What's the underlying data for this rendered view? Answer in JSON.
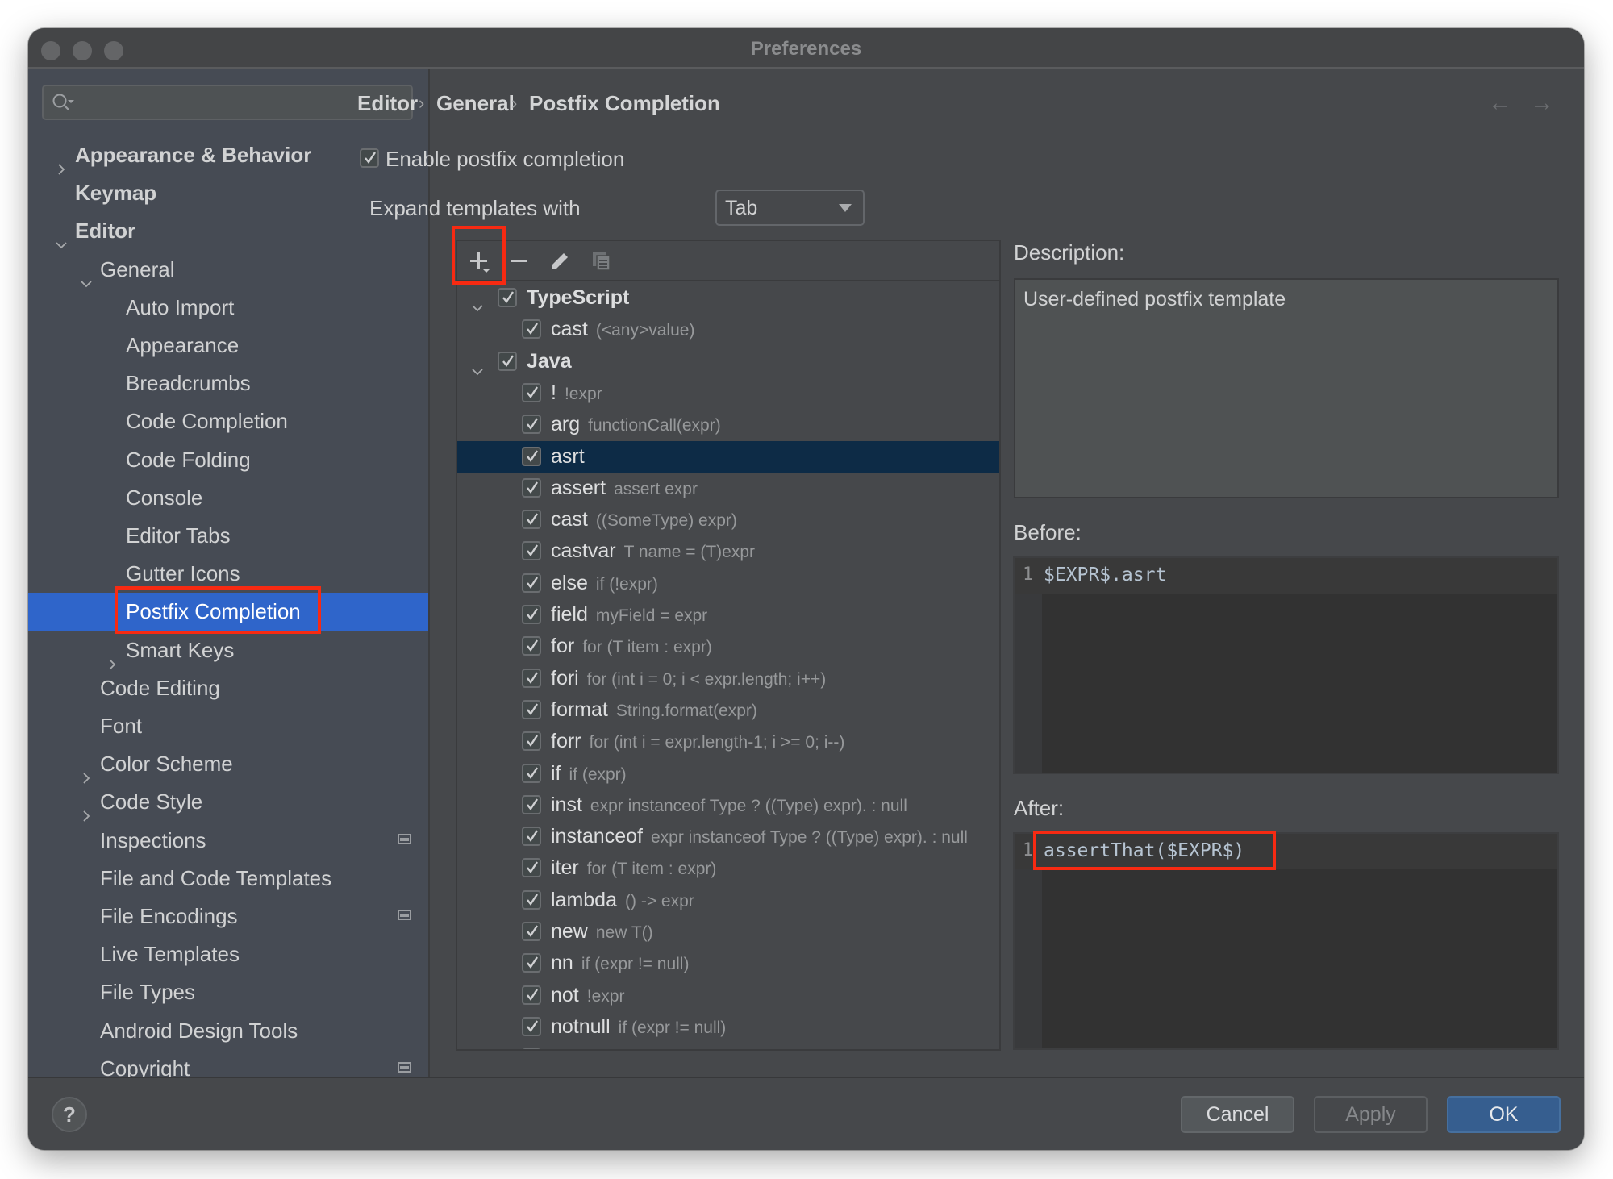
{
  "window": {
    "title": "Preferences"
  },
  "sidebar": {
    "search": {
      "value": "",
      "placeholder": ""
    },
    "items": [
      {
        "label": "Appearance & Behavior",
        "level": 0,
        "bold": true,
        "chevron": "right"
      },
      {
        "label": "Keymap",
        "level": 0,
        "bold": true,
        "chevron": ""
      },
      {
        "label": "Editor",
        "level": 0,
        "bold": true,
        "chevron": "down"
      },
      {
        "label": "General",
        "level": 1,
        "bold": false,
        "chevron": "down"
      },
      {
        "label": "Auto Import",
        "level": 2,
        "bold": false,
        "chevron": ""
      },
      {
        "label": "Appearance",
        "level": 2,
        "bold": false,
        "chevron": ""
      },
      {
        "label": "Breadcrumbs",
        "level": 2,
        "bold": false,
        "chevron": ""
      },
      {
        "label": "Code Completion",
        "level": 2,
        "bold": false,
        "chevron": ""
      },
      {
        "label": "Code Folding",
        "level": 2,
        "bold": false,
        "chevron": ""
      },
      {
        "label": "Console",
        "level": 2,
        "bold": false,
        "chevron": ""
      },
      {
        "label": "Editor Tabs",
        "level": 2,
        "bold": false,
        "chevron": ""
      },
      {
        "label": "Gutter Icons",
        "level": 2,
        "bold": false,
        "chevron": ""
      },
      {
        "label": "Postfix Completion",
        "level": 2,
        "bold": false,
        "chevron": "",
        "selected": true
      },
      {
        "label": "Smart Keys",
        "level": 2,
        "bold": false,
        "chevron": "right"
      },
      {
        "label": "Code Editing",
        "level": 1,
        "bold": false,
        "chevron": ""
      },
      {
        "label": "Font",
        "level": 1,
        "bold": false,
        "chevron": ""
      },
      {
        "label": "Color Scheme",
        "level": 1,
        "bold": false,
        "chevron": "right"
      },
      {
        "label": "Code Style",
        "level": 1,
        "bold": false,
        "chevron": "right"
      },
      {
        "label": "Inspections",
        "level": 1,
        "bold": false,
        "chevron": "",
        "project_icon": true
      },
      {
        "label": "File and Code Templates",
        "level": 1,
        "bold": false,
        "chevron": ""
      },
      {
        "label": "File Encodings",
        "level": 1,
        "bold": false,
        "chevron": "",
        "project_icon": true
      },
      {
        "label": "Live Templates",
        "level": 1,
        "bold": false,
        "chevron": ""
      },
      {
        "label": "File Types",
        "level": 1,
        "bold": false,
        "chevron": ""
      },
      {
        "label": "Android Design Tools",
        "level": 1,
        "bold": false,
        "chevron": ""
      },
      {
        "label": "Copyright",
        "level": 1,
        "bold": false,
        "chevron": "right",
        "project_icon": true
      }
    ]
  },
  "breadcrumb": [
    "Editor",
    "General",
    "Postfix Completion"
  ],
  "settings": {
    "enable_label": "Enable postfix completion",
    "enable_checked": true,
    "expand_label": "Expand templates with",
    "expand_value": "Tab"
  },
  "toolbar": {
    "add": "add-icon",
    "remove": "remove-icon",
    "edit": "edit-icon",
    "copy": "copy-icon"
  },
  "templates": [
    {
      "name": "TypeScript",
      "group": true,
      "checked": true,
      "hint": ""
    },
    {
      "name": "cast",
      "group": false,
      "checked": true,
      "hint": "(<any>value)"
    },
    {
      "name": "Java",
      "group": true,
      "checked": true,
      "hint": ""
    },
    {
      "name": "!",
      "group": false,
      "checked": true,
      "hint": "!expr"
    },
    {
      "name": "arg",
      "group": false,
      "checked": true,
      "hint": "functionCall(expr)"
    },
    {
      "name": "asrt",
      "group": false,
      "checked": true,
      "hint": "",
      "selected": true
    },
    {
      "name": "assert",
      "group": false,
      "checked": true,
      "hint": "assert expr"
    },
    {
      "name": "cast",
      "group": false,
      "checked": true,
      "hint": "((SomeType) expr)"
    },
    {
      "name": "castvar",
      "group": false,
      "checked": true,
      "hint": "T name = (T)expr"
    },
    {
      "name": "else",
      "group": false,
      "checked": true,
      "hint": "if (!expr)"
    },
    {
      "name": "field",
      "group": false,
      "checked": true,
      "hint": "myField = expr"
    },
    {
      "name": "for",
      "group": false,
      "checked": true,
      "hint": "for (T item : expr)"
    },
    {
      "name": "fori",
      "group": false,
      "checked": true,
      "hint": "for (int i = 0; i < expr.length; i++)"
    },
    {
      "name": "format",
      "group": false,
      "checked": true,
      "hint": "String.format(expr)"
    },
    {
      "name": "forr",
      "group": false,
      "checked": true,
      "hint": "for (int i = expr.length-1; i >= 0; i--)"
    },
    {
      "name": "if",
      "group": false,
      "checked": true,
      "hint": "if (expr)"
    },
    {
      "name": "inst",
      "group": false,
      "checked": true,
      "hint": "expr instanceof Type ? ((Type) expr). : null"
    },
    {
      "name": "instanceof",
      "group": false,
      "checked": true,
      "hint": "expr instanceof Type ? ((Type) expr). : null"
    },
    {
      "name": "iter",
      "group": false,
      "checked": true,
      "hint": "for (T item : expr)"
    },
    {
      "name": "lambda",
      "group": false,
      "checked": true,
      "hint": "() -> expr"
    },
    {
      "name": "new",
      "group": false,
      "checked": true,
      "hint": "new T()"
    },
    {
      "name": "nn",
      "group": false,
      "checked": true,
      "hint": "if (expr != null)"
    },
    {
      "name": "not",
      "group": false,
      "checked": true,
      "hint": "!expr"
    },
    {
      "name": "notnull",
      "group": false,
      "checked": true,
      "hint": "if (expr != null)"
    },
    {
      "name": "",
      "group": false,
      "checked": true,
      "hint": ""
    }
  ],
  "details": {
    "description_label": "Description:",
    "description_text": "User-defined postfix template",
    "before_label": "Before:",
    "before_line_number": "1",
    "before_code": "$EXPR$.asrt",
    "after_label": "After:",
    "after_line_number": "1",
    "after_code": "assertThat($EXPR$)"
  },
  "footer": {
    "help": "?",
    "cancel": "Cancel",
    "apply": "Apply",
    "ok": "OK"
  },
  "colors": {
    "selection_sidebar": "#2f65ca",
    "selection_tree": "#0d2b46",
    "annotation_red": "#f72a12",
    "ok_button": "#365e8f"
  }
}
